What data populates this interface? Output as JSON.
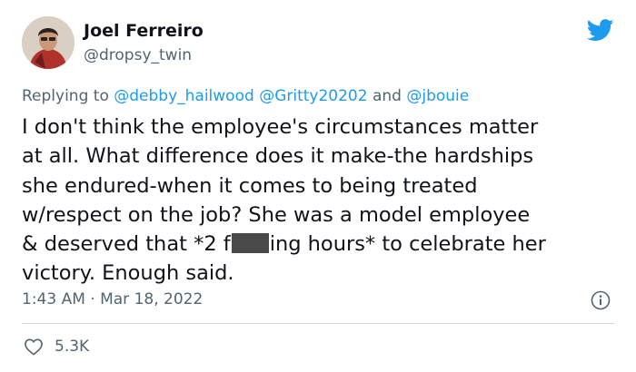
{
  "tweet": {
    "author": {
      "name": "Joel Ferreiro",
      "handle": "@dropsy_twin"
    },
    "reply": {
      "prefix": "Replying to ",
      "mention1": "@debby_hailwood",
      "mention2": "@Gritty20202",
      "joiner": " and ",
      "mention3": "@jbouie"
    },
    "body": {
      "line1": "I don't think the employee's circumstances matter",
      "line2": "at all. What difference does it make-the hardships",
      "line3": "she endured-when it comes to being treated",
      "line4": "w/respect on the job? She was a model employee",
      "line5_before": "& deserved that *2 f",
      "line5_after": "ing hours* to celebrate her",
      "line6": "victory. Enough said."
    },
    "timestamp": "1:43 AM · Mar 18, 2022",
    "likes": "5.3K"
  },
  "icons": {
    "brand": "twitter-bird-icon",
    "info": "info-icon",
    "like": "heart-icon"
  },
  "colors": {
    "brand_blue": "#1d9bf0",
    "secondary_text": "#536471",
    "censor_bar": "#4a4a4a"
  }
}
